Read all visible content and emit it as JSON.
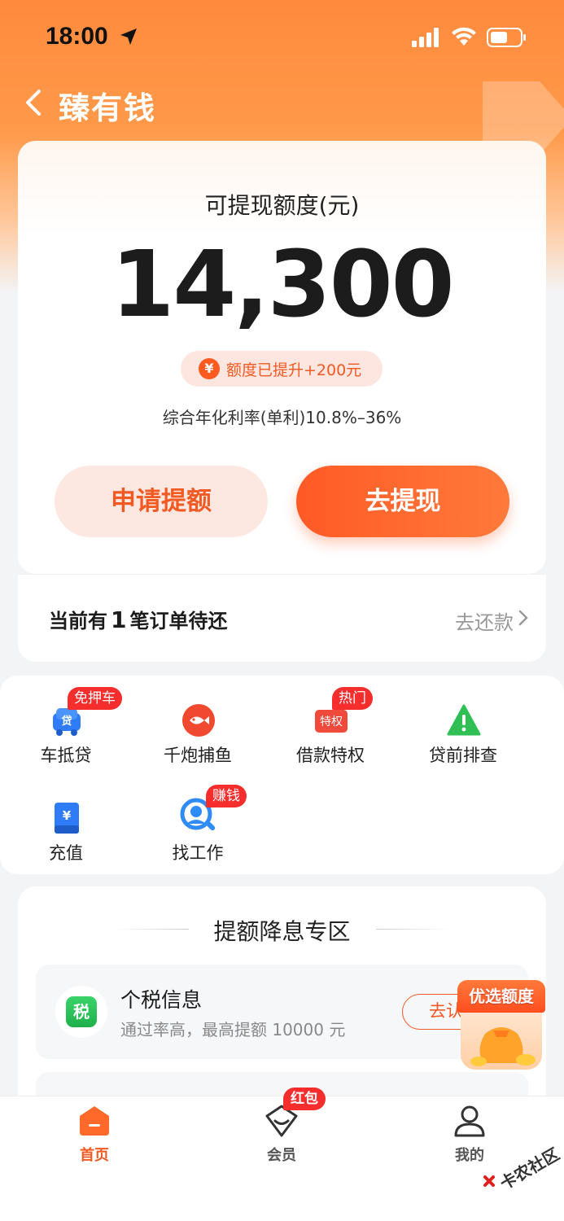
{
  "status_bar": {
    "time": "18:00"
  },
  "nav": {
    "title": "臻有钱"
  },
  "quota": {
    "label": "可提现额度(元)",
    "value": "14,300",
    "raise_badge": "额度已提升+200元",
    "raise_icon": "¥",
    "rate": "综合年化利率(单利)10.8%–36%"
  },
  "buttons": {
    "apply": "申请提额",
    "withdraw": "去提现"
  },
  "pending": {
    "prefix": "当前有",
    "count": "1",
    "suffix": "笔订单待还",
    "link": "去还款"
  },
  "services": [
    {
      "label": "车抵贷",
      "badge": "免押车",
      "icon": "car-loan-icon",
      "icon_text": "贷"
    },
    {
      "label": "千炮捕鱼",
      "badge": "",
      "icon": "fish-icon"
    },
    {
      "label": "借款特权",
      "badge": "热门",
      "icon": "privilege-icon",
      "icon_text": "特权"
    },
    {
      "label": "贷前排查",
      "badge": "",
      "icon": "warning-icon"
    },
    {
      "label": "充值",
      "badge": "",
      "icon": "recharge-icon",
      "icon_text": "¥"
    },
    {
      "label": "找工作",
      "badge": "赚钱",
      "icon": "job-search-icon"
    }
  ],
  "promo": {
    "title": "提额降息专区",
    "item": {
      "icon_text": "税",
      "title": "个税信息",
      "desc": "通过率高，最高提额 10000 元",
      "button": "去认"
    }
  },
  "float_promo": {
    "title": "优选额度"
  },
  "tabbar": {
    "home": "首页",
    "member": "会员",
    "member_badge": "红包",
    "mine": "我的"
  },
  "watermark": "卡农社区",
  "colors": {
    "accent": "#f25a24",
    "badge_red": "#f52d2d",
    "header_orange": "#ff8a3d"
  }
}
